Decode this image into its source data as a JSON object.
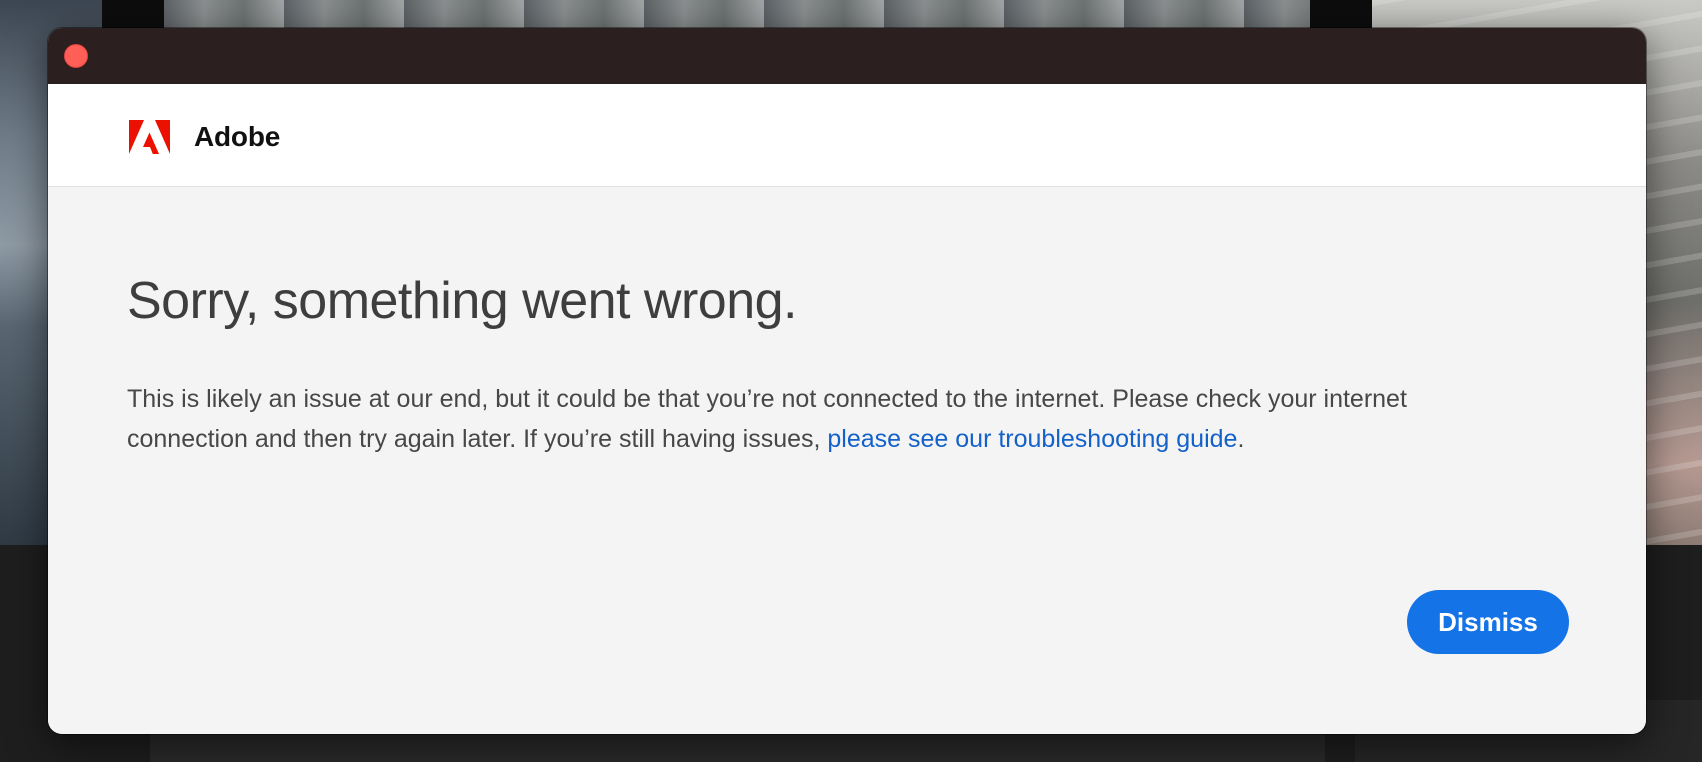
{
  "window": {
    "close_label": "Close"
  },
  "header": {
    "brand_name": "Adobe",
    "logo_icon": "adobe-logo-icon"
  },
  "error": {
    "heading": "Sorry, something went wrong.",
    "message_part1": "This is likely an issue at our end, but it could be that you’re not connected to the internet. Please check your internet connection and then try again later. If you’re still having issues, ",
    "link_text": "please see our troubleshooting guide",
    "message_end": "."
  },
  "actions": {
    "dismiss_label": "Dismiss"
  },
  "colors": {
    "titlebar": "#2b1f1f",
    "close_button": "#ff5f57",
    "brand_red": "#eb1000",
    "link": "#1361c9",
    "primary_button": "#1473e6"
  }
}
